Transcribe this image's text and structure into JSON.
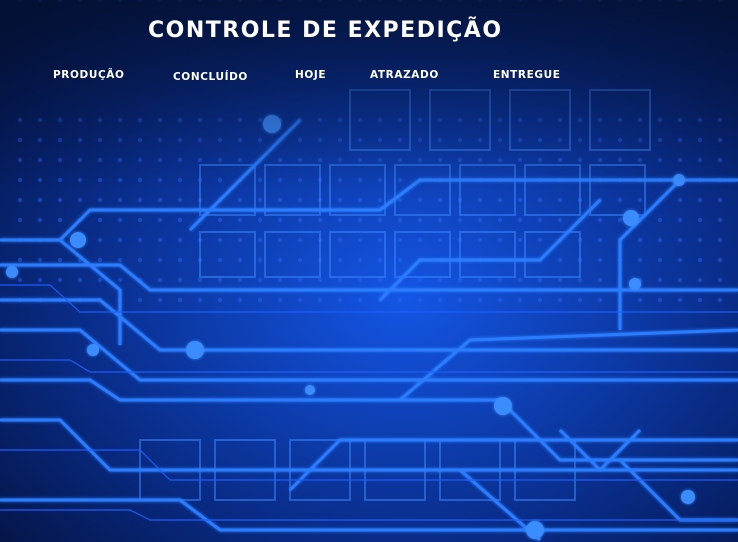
{
  "page": {
    "title": "CONTROLE DE EXPEDIÇÃO"
  },
  "nav": {
    "items": [
      {
        "label": "PRODUÇÃO"
      },
      {
        "label": "CONCLUÍDO"
      },
      {
        "label": "HOJE"
      },
      {
        "label": "ATRAZADO"
      },
      {
        "label": "ENTREGUE"
      }
    ]
  },
  "background": {
    "theme": "blue-circuit-board",
    "base_color": "#061a4a",
    "accent_color": "#1a6bff",
    "glow_color": "#3fa0ff"
  }
}
